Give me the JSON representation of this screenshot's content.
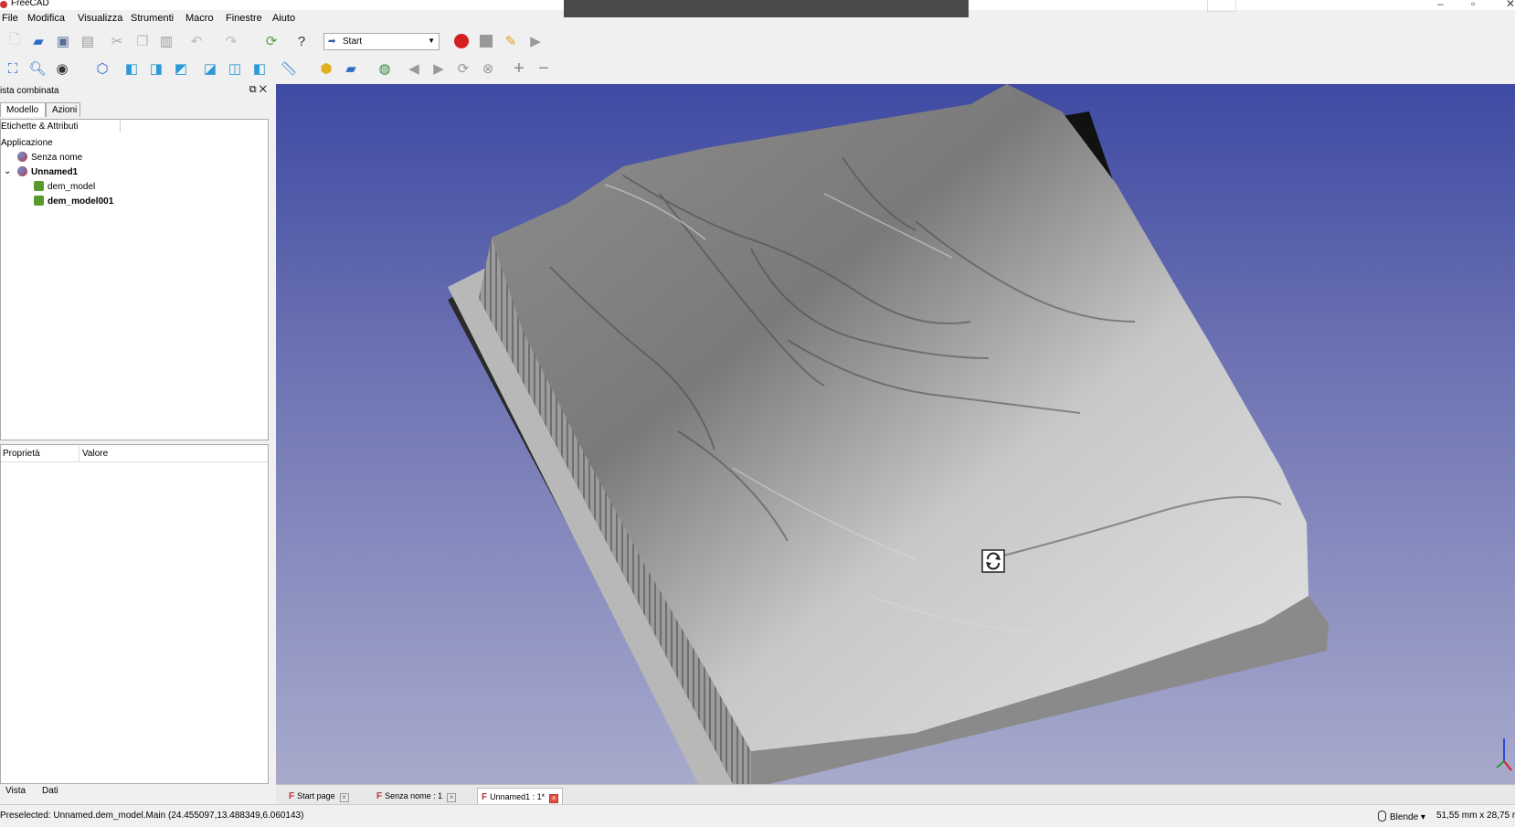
{
  "window": {
    "title": "FreeCAD"
  },
  "menu": [
    "File",
    "Modifica",
    "Visualizza",
    "Strumenti",
    "Macro",
    "Finestre",
    "Aiuto"
  ],
  "toolbar": {
    "workbench": "Start"
  },
  "combo_view": {
    "title": "ista combinata",
    "tabs": [
      "Modello",
      "Azioni"
    ],
    "tree": {
      "header": "Etichette & Attributi",
      "root": "Applicazione",
      "items": [
        "Senza nome",
        "Unnamed1",
        "dem_model",
        "dem_model001"
      ]
    },
    "properties": {
      "col1": "Proprietà",
      "col2": "Valore"
    },
    "bottom_tabs": [
      "Vista",
      "Dati"
    ]
  },
  "doc_tabs": [
    "Start page",
    "Senza nome : 1",
    "Unnamed1 : 1*"
  ],
  "status": {
    "preselected": "Preselected: Unnamed.dem_model.Main (24.455097,13.488349,6.060143)",
    "nav_style": "Blende",
    "dimensions": "51,55 mm x 28,75 r"
  },
  "colors": {
    "background_top": "#3f4aa3",
    "background_bottom": "#a8aacc",
    "record_button": "#d42020"
  }
}
